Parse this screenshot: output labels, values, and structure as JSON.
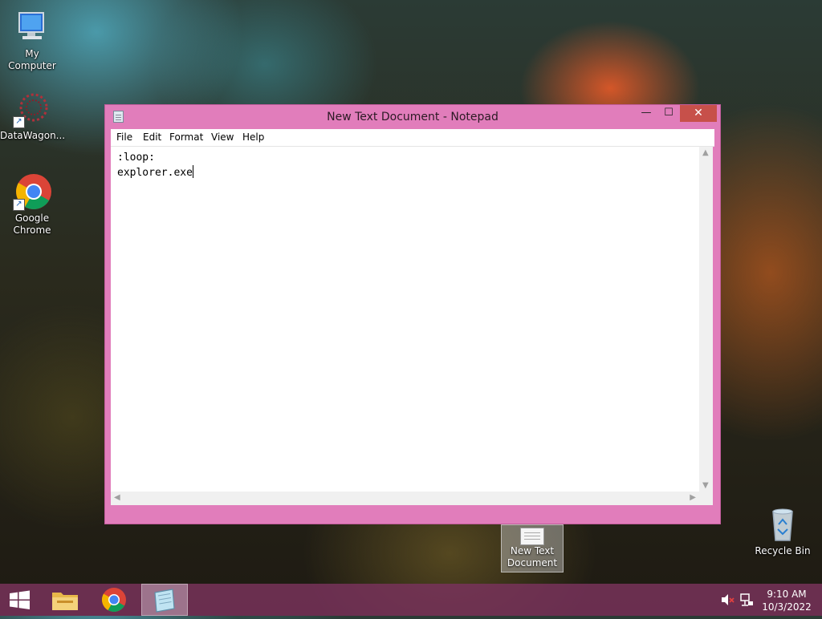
{
  "desktop": {
    "icons": [
      {
        "label": "My Computer"
      },
      {
        "label": "DataWagon..."
      },
      {
        "label": "Google Chrome"
      },
      {
        "label": "Recycle Bin"
      }
    ],
    "selected_file": {
      "line1": "New Text",
      "line2": "Document"
    }
  },
  "window": {
    "title": "New Text Document - Notepad",
    "controls": {
      "minimize": "—",
      "maximize": "☐",
      "close": "✕"
    },
    "menu": [
      "File",
      "Edit",
      "Format",
      "View",
      "Help"
    ],
    "content": {
      "line1": ":loop:",
      "line2": "explorer.exe"
    }
  },
  "taskbar": {
    "time": "9:10 AM",
    "date": "10/3/2022",
    "accent": "#7a3260"
  },
  "icons": {
    "start": "windows-logo-icon",
    "explorer": "folder-icon",
    "chrome": "chrome-icon",
    "notepad": "notepad-icon",
    "volume": "volume-muted-icon",
    "network": "network-icon"
  }
}
